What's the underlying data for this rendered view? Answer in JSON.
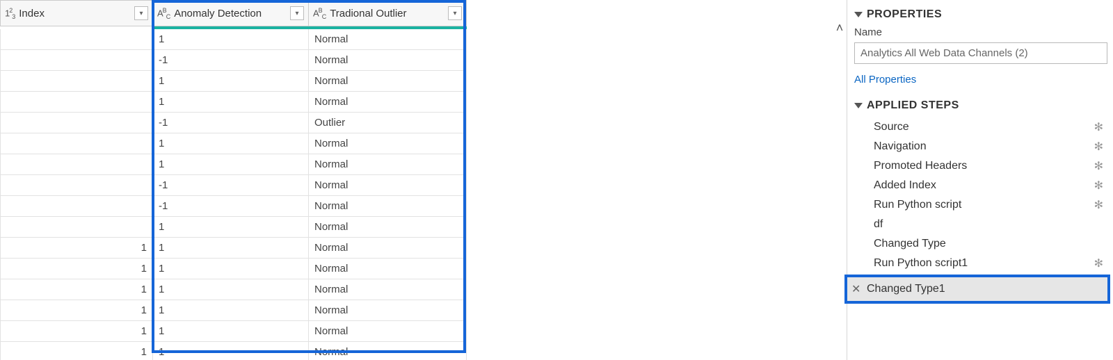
{
  "columns": {
    "c0": {
      "type_label": "1 2 3",
      "name": "Index"
    },
    "c1": {
      "type_label": "A B C",
      "name": "Anomaly Detection"
    },
    "c2": {
      "type_label": "A B C",
      "name": "Tradional Outlier"
    }
  },
  "rows": [
    {
      "index": "",
      "anomaly": "1",
      "outlier": "Normal"
    },
    {
      "index": "",
      "anomaly": "-1",
      "outlier": "Normal"
    },
    {
      "index": "",
      "anomaly": "1",
      "outlier": "Normal"
    },
    {
      "index": "",
      "anomaly": "1",
      "outlier": "Normal"
    },
    {
      "index": "",
      "anomaly": "-1",
      "outlier": "Outlier"
    },
    {
      "index": "",
      "anomaly": "1",
      "outlier": "Normal"
    },
    {
      "index": "",
      "anomaly": "1",
      "outlier": "Normal"
    },
    {
      "index": "",
      "anomaly": "-1",
      "outlier": "Normal"
    },
    {
      "index": "",
      "anomaly": "-1",
      "outlier": "Normal"
    },
    {
      "index": "",
      "anomaly": "1",
      "outlier": "Normal"
    },
    {
      "index": "1",
      "anomaly": "1",
      "outlier": "Normal"
    },
    {
      "index": "1",
      "anomaly": "1",
      "outlier": "Normal"
    },
    {
      "index": "1",
      "anomaly": "1",
      "outlier": "Normal"
    },
    {
      "index": "1",
      "anomaly": "1",
      "outlier": "Normal"
    },
    {
      "index": "1",
      "anomaly": "1",
      "outlier": "Normal"
    },
    {
      "index": "1",
      "anomaly": "1",
      "outlier": "Normal"
    }
  ],
  "panel": {
    "properties_header": "PROPERTIES",
    "name_label": "Name",
    "name_value": "Analytics All Web Data Channels (2)",
    "all_properties": "All Properties",
    "applied_header": "APPLIED STEPS"
  },
  "steps": [
    {
      "label": "Source",
      "gear": true
    },
    {
      "label": "Navigation",
      "gear": true
    },
    {
      "label": "Promoted Headers",
      "gear": true
    },
    {
      "label": "Added Index",
      "gear": true
    },
    {
      "label": "Run Python script",
      "gear": true
    },
    {
      "label": "df",
      "gear": false
    },
    {
      "label": "Changed Type",
      "gear": false
    },
    {
      "label": "Run Python script1",
      "gear": true
    }
  ],
  "selected_step": {
    "label": "Changed Type1"
  },
  "icons": {
    "dropdown": "▾",
    "gear": "✻",
    "delete": "✕",
    "scroll_up": "˄"
  }
}
